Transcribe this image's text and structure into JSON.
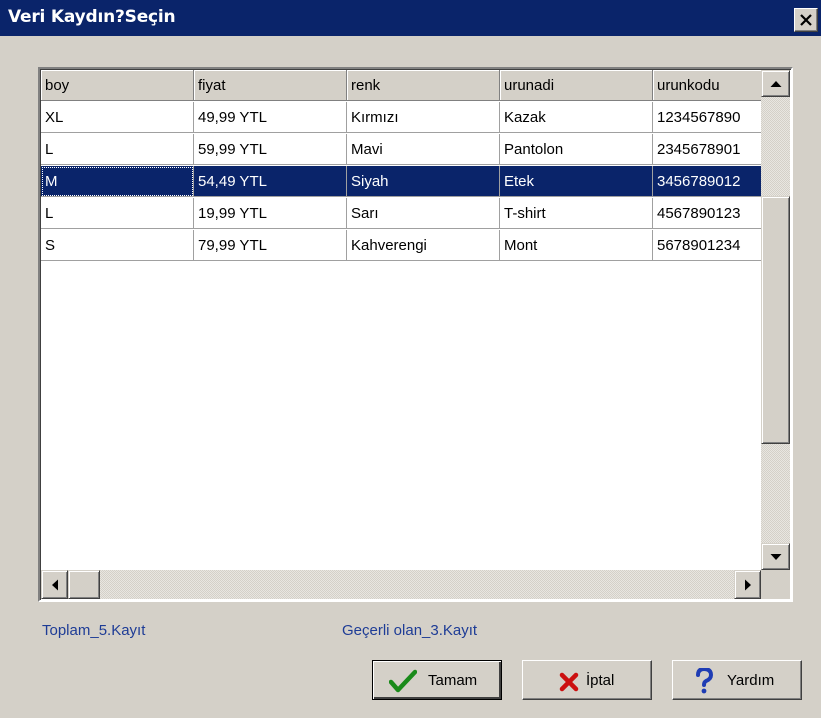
{
  "window": {
    "title": "Veri Kaydın?Seçin"
  },
  "grid": {
    "columns": [
      "boy",
      "fiyat",
      "renk",
      "urunadi",
      "urunkodu"
    ],
    "rows": [
      [
        "XL",
        "49,99 YTL",
        "Kırmızı",
        "Kazak",
        "1234567890"
      ],
      [
        "L",
        "59,99 YTL",
        "Mavi",
        "Pantolon",
        "2345678901"
      ],
      [
        "M",
        "54,49 YTL",
        "Siyah",
        "Etek",
        "3456789012"
      ],
      [
        "L",
        "19,99 YTL",
        "Sarı",
        "T-shirt",
        "4567890123"
      ],
      [
        "S",
        "79,99 YTL",
        "Kahverengi",
        "Mont",
        "5678901234"
      ]
    ],
    "selected_row_index": 2
  },
  "status": {
    "total": "Toplam_5.Kayıt",
    "current": "Geçerli olan_3.Kayıt"
  },
  "buttons": {
    "ok": "Tamam",
    "cancel": "İptal",
    "help": "Yardım"
  },
  "colors": {
    "title_bar": "#0a246a",
    "selection": "#0a246a",
    "status_text": "#1e3c96",
    "dialog_face": "#d4d0c8"
  },
  "icons": {
    "ok": "check-icon",
    "cancel": "x-icon",
    "help": "question-icon",
    "close": "close-icon"
  }
}
